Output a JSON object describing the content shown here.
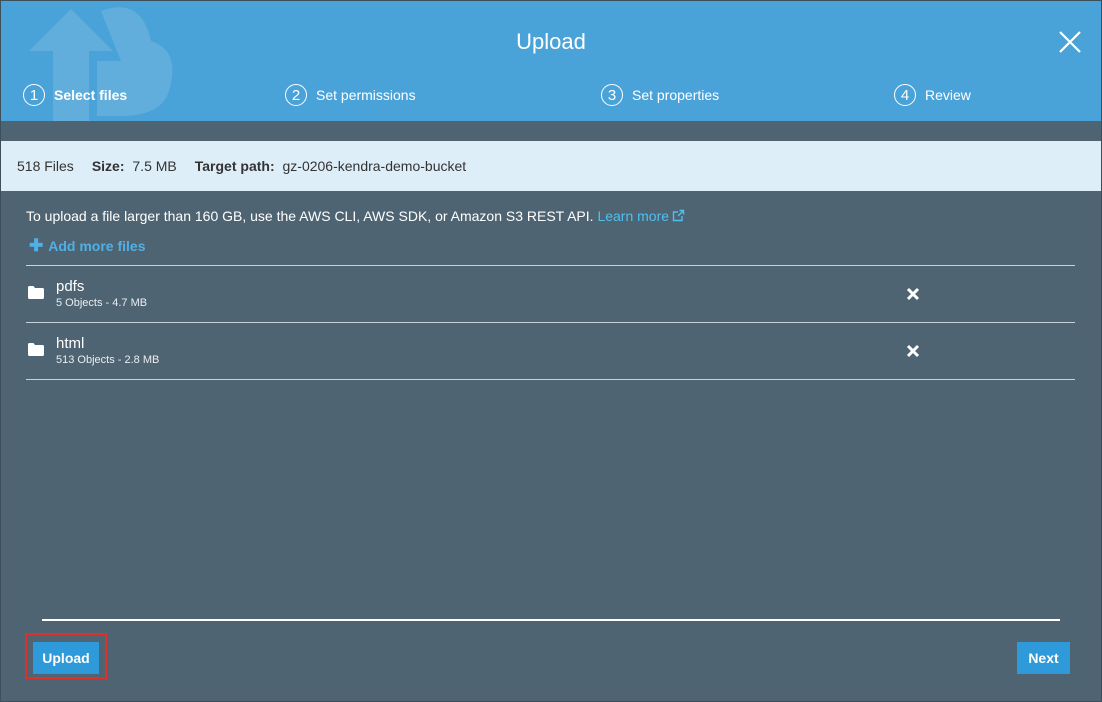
{
  "dialog": {
    "title": "Upload",
    "steps": [
      {
        "number": "1",
        "label": "Select files",
        "active": true
      },
      {
        "number": "2",
        "label": "Set permissions",
        "active": false
      },
      {
        "number": "3",
        "label": "Set properties",
        "active": false
      },
      {
        "number": "4",
        "label": "Review",
        "active": false
      }
    ]
  },
  "summary": {
    "files": "518 Files",
    "size_label": "Size:",
    "size_value": "7.5 MB",
    "target_label": "Target path:",
    "target_value": "gz-0206-kendra-demo-bucket"
  },
  "notice": {
    "text": "To upload a file larger than 160 GB, use the AWS CLI, AWS SDK, or Amazon S3 REST API.",
    "link": "Learn more"
  },
  "add_more": "Add more files",
  "items": [
    {
      "name": "pdfs",
      "meta": "5 Objects - 4.7 MB"
    },
    {
      "name": "html",
      "meta": "513 Objects - 2.8 MB"
    }
  ],
  "buttons": {
    "upload": "Upload",
    "next": "Next"
  },
  "colors": {
    "header": "#4aa3d8",
    "body": "#4f6472",
    "summary": "#ddeef9",
    "primary_button": "#2e9ad9",
    "highlight": "#e0302a"
  }
}
